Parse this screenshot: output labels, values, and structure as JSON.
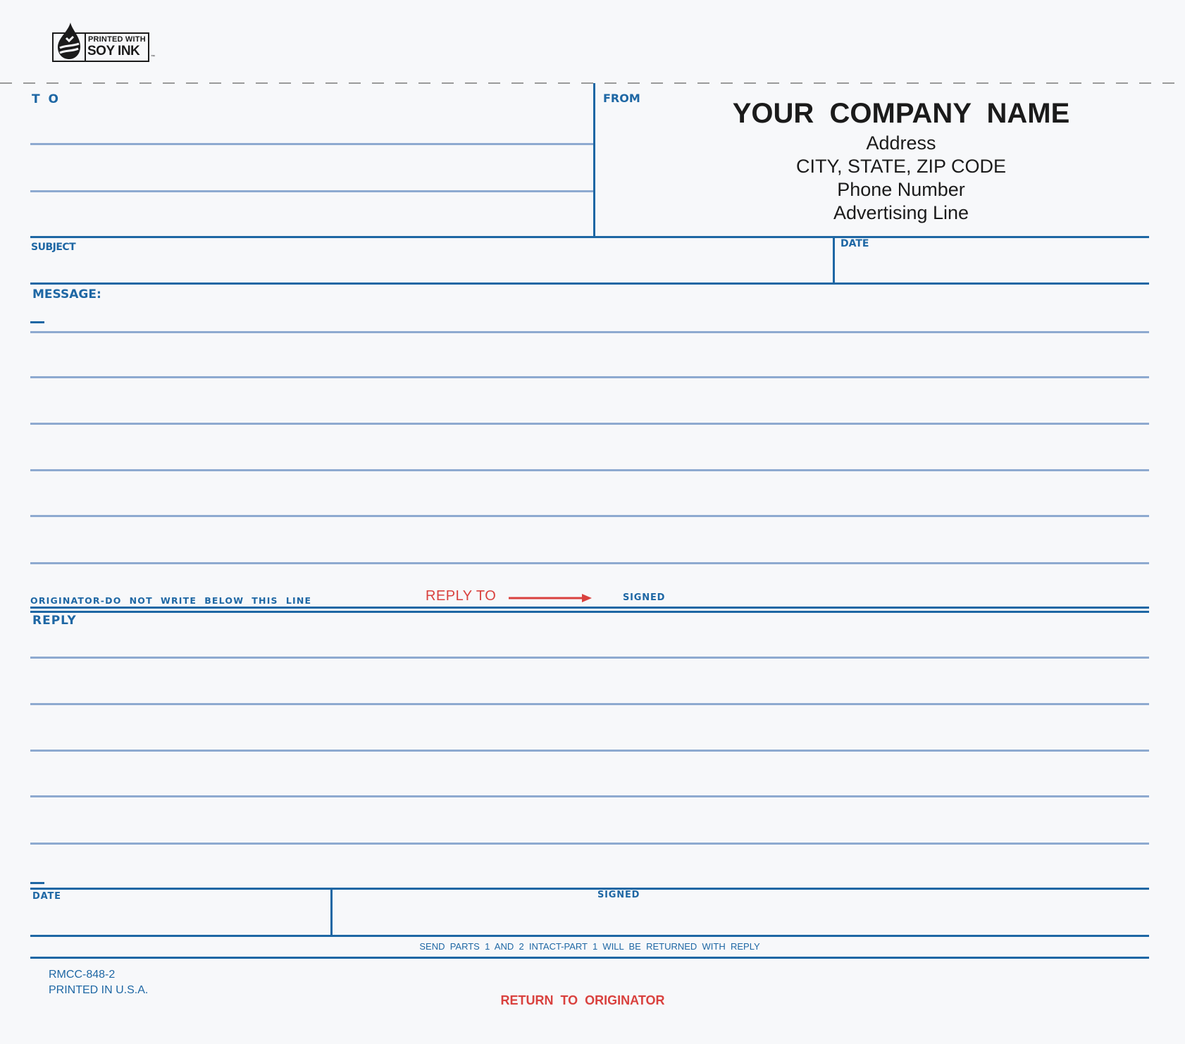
{
  "logo": {
    "line1": "PRINTED WITH",
    "line2": "SOY INK",
    "tm": "™",
    "icon": "soy-ink-drop-icon"
  },
  "header": {
    "to_label": "T O",
    "from_label": "FROM",
    "company_name": "YOUR  COMPANY  NAME",
    "address": "Address",
    "city_state_zip": "CITY, STATE, ZIP CODE",
    "phone": "Phone Number",
    "advertising": "Advertising Line"
  },
  "subject_label": "SUBJECT",
  "date_label": "DATE",
  "message_label": "MESSAGE:",
  "originator_note": "ORIGINATOR-DO  NOT  WRITE  BELOW  THIS  LINE",
  "reply_to": "REPLY TO",
  "signed_label": "SIGNED",
  "reply_label": "REPLY",
  "footer": {
    "date_label": "DATE",
    "signed_label": "SIGNED",
    "instructions": "SEND  PARTS  1  AND  2  INTACT-PART  1  WILL  BE  RETURNED  WITH  REPLY",
    "form_number": "RMCC-848-2",
    "printed_in": "PRINTED IN U.S.A.",
    "return_note": "RETURN  TO  ORIGINATOR"
  },
  "colors": {
    "form_blue": "#1e67a4",
    "rule_blue": "#8eaad0",
    "accent_red": "#d9413e"
  }
}
